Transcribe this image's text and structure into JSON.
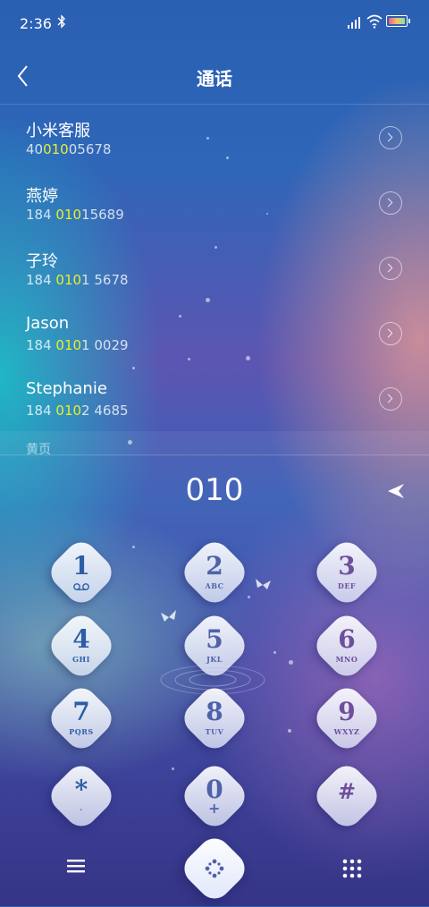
{
  "status_bar": {
    "time": "2:36",
    "bluetooth_icon": "bluetooth-icon",
    "signal_icon": "signal-icon",
    "wifi_icon": "wifi-icon",
    "battery_icon": "battery-icon"
  },
  "header": {
    "title": "通话",
    "back_icon": "back-arrow-icon"
  },
  "results": [
    {
      "name": "小米客服",
      "num_pre": "40",
      "num_hl": "010",
      "num_post": "05678"
    },
    {
      "name": "燕婷",
      "num_pre": "184 ",
      "num_hl": "010",
      "num_post": "15689"
    },
    {
      "name": "子玲",
      "num_pre": "184 ",
      "num_hl": "010",
      "num_post": "1 5678"
    },
    {
      "name": "Jason",
      "num_pre": "184 ",
      "num_hl": "010",
      "num_post": "1 0029"
    },
    {
      "name": "Stephanie",
      "num_pre": "184 ",
      "num_hl": "010",
      "num_post": "2 4685"
    }
  ],
  "section_label": "黄页",
  "dialed_number": "010",
  "keypad": [
    {
      "digit": "1",
      "sub": "",
      "voicemail": true
    },
    {
      "digit": "2",
      "sub": "ABC"
    },
    {
      "digit": "3",
      "sub": "DEF"
    },
    {
      "digit": "4",
      "sub": "GHI"
    },
    {
      "digit": "5",
      "sub": "JKL"
    },
    {
      "digit": "6",
      "sub": "MNO"
    },
    {
      "digit": "7",
      "sub": "PQRS"
    },
    {
      "digit": "8",
      "sub": "TUV"
    },
    {
      "digit": "9",
      "sub": "WXYZ"
    },
    {
      "digit": "*",
      "sub": "·"
    },
    {
      "digit": "0",
      "sub": "+"
    },
    {
      "digit": "#",
      "sub": ""
    }
  ],
  "bottom_bar": {
    "left_icon": "menu-icon",
    "center_icon": "dialpad-toggle-icon",
    "right_icon": "grid-icon"
  },
  "colors": {
    "highlight": "#e6ef30",
    "key_blue": "#2d5da8",
    "key_violet": "#6d4f9b"
  }
}
